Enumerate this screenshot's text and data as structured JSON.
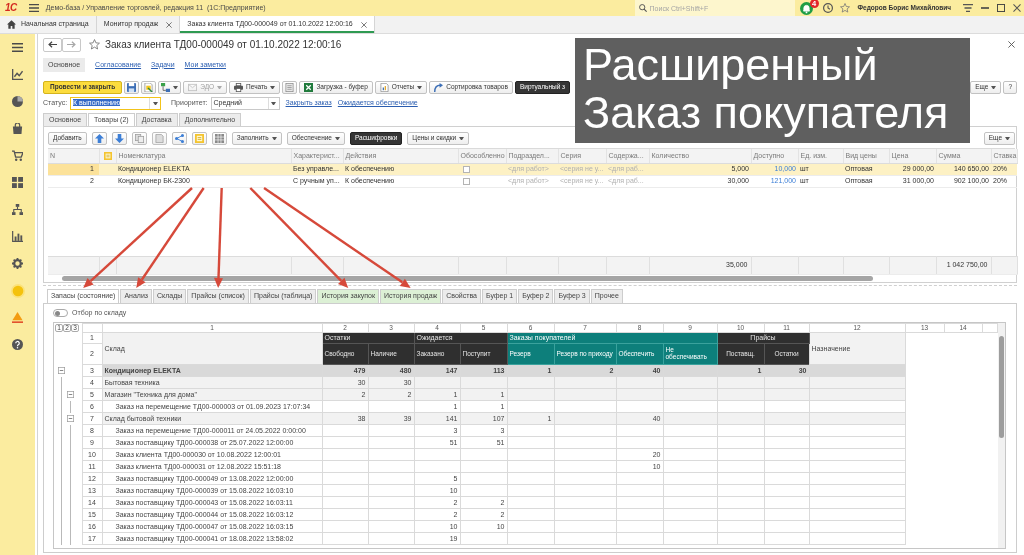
{
  "app_bar": {
    "logo": "1С",
    "title": "Демо-база / Управление торговлей, редакция 11  (1С:Предприятие)",
    "search": {
      "placeholder": "Поиск Ctrl+Shift+F"
    },
    "notification_count": "4",
    "user": "Федоров Борис Михайлович"
  },
  "open_tabs": [
    {
      "kind": "home",
      "label": "Начальная страница",
      "selected": false
    },
    {
      "kind": "document",
      "label": "Монитор продаж",
      "selected": false
    },
    {
      "kind": "document",
      "label": "Заказ клиента ТД00-000049 от 01.10.2022 12:00:16",
      "selected": true
    }
  ],
  "form": {
    "title": "Заказ клиента ТД00-000049 от 01.10.2022 12:00:16",
    "sections": [
      {
        "label": "Основное",
        "selected": true
      },
      {
        "label": "Согласование",
        "selected": false
      },
      {
        "label": "Задачи",
        "selected": false
      },
      {
        "label": "Мои заметки",
        "selected": false
      }
    ],
    "commands": [
      {
        "kind": "primary",
        "label": "Провести и закрыть",
        "dropdown": false,
        "disabled": false
      },
      {
        "kind": "icon",
        "dropdown": false,
        "disabled": false
      },
      {
        "kind": "icon",
        "dropdown": false,
        "disabled": false
      },
      {
        "kind": "icon",
        "dropdown": true,
        "disabled": false
      },
      {
        "kind": "icon-text",
        "label": "ЭДО",
        "dropdown": true,
        "disabled": true
      },
      {
        "kind": "icon-text",
        "label": "Печать",
        "dropdown": true,
        "disabled": false
      },
      {
        "kind": "icon",
        "dropdown": false,
        "disabled": false
      },
      {
        "kind": "icon-text",
        "label": "Загрузка - буфер",
        "dropdown": false,
        "disabled": false
      },
      {
        "kind": "icon-text",
        "label": "Отчеты",
        "dropdown": true,
        "disabled": false
      },
      {
        "kind": "icon-text",
        "label": "Сортировка товаров",
        "dropdown": false,
        "disabled": false
      },
      {
        "kind": "toggle",
        "label": "Виртуальный з",
        "dropdown": false,
        "disabled": false
      }
    ],
    "commands_right": [
      {
        "kind": "text",
        "label": "Еще",
        "dropdown": true,
        "disabled": false
      },
      {
        "kind": "text",
        "label": "?",
        "dropdown": false,
        "disabled": false
      }
    ],
    "fields": [
      {
        "label": "Статус:",
        "value": "К выполнению",
        "focused": true
      },
      {
        "label": "Приоритет:",
        "value": "Средний",
        "focused": false
      }
    ],
    "links": [
      "Закрыть заказ",
      "Ожидается обеспечение"
    ],
    "tabs": [
      {
        "label": "Основное",
        "selected": false
      },
      {
        "label": "Товары (2)",
        "selected": true
      },
      {
        "label": "Доставка",
        "selected": false
      },
      {
        "label": "Дополнительно",
        "selected": false
      }
    ],
    "goods": {
      "toolbar": [
        {
          "kind": "text",
          "label": "Добавить",
          "dropdown": false,
          "disabled": false
        },
        {
          "kind": "icon",
          "dropdown": false,
          "disabled": false
        },
        {
          "kind": "icon",
          "dropdown": false,
          "disabled": false
        },
        {
          "kind": "icon",
          "dropdown": false,
          "disabled": false
        },
        {
          "kind": "icon",
          "dropdown": false,
          "disabled": false
        },
        {
          "kind": "icon",
          "dropdown": false,
          "disabled": false
        },
        {
          "kind": "icon",
          "dropdown": false,
          "disabled": false
        },
        {
          "kind": "icon",
          "dropdown": false,
          "disabled": false
        },
        {
          "kind": "text",
          "label": "Заполнить",
          "dropdown": true,
          "disabled": false
        },
        {
          "kind": "text",
          "label": "Обеспечение",
          "dropdown": true,
          "disabled": false
        },
        {
          "kind": "toggle",
          "label": "Расшифровки",
          "dropdown": false,
          "disabled": false
        },
        {
          "kind": "text",
          "label": "Цены и скидки",
          "dropdown": true,
          "disabled": false
        }
      ],
      "toolbar_right": [
        {
          "kind": "text",
          "label": "Еще",
          "dropdown": true,
          "disabled": false
        }
      ],
      "columns": [
        {
          "kind": "text",
          "label": "N"
        },
        {
          "kind": "icon"
        },
        {
          "kind": "text",
          "label": "Номенклатура"
        },
        {
          "kind": "text",
          "label": "Характерист..."
        },
        {
          "kind": "text",
          "label": "Действия"
        },
        {
          "kind": "text",
          "label": "Обособленно"
        },
        {
          "kind": "text",
          "label": "Подраздел..."
        },
        {
          "kind": "text",
          "label": "Серия"
        },
        {
          "kind": "text",
          "label": "Содержа..."
        },
        {
          "kind": "text",
          "label": "Количество"
        },
        {
          "kind": "text",
          "label": "Доступно"
        },
        {
          "kind": "text",
          "label": "Ед. изм."
        },
        {
          "kind": "text",
          "label": "Вид цены"
        },
        {
          "kind": "text",
          "label": "Цена"
        },
        {
          "kind": "text",
          "label": "Сумма"
        },
        {
          "kind": "text",
          "label": "Ставка"
        }
      ],
      "rows": [
        {
          "selected": true,
          "n": "1",
          "name": "Кондиционер ELEKTA",
          "characteristic": "Без управле...",
          "action": "К обеспечению",
          "separate": false,
          "division": "<для работ>",
          "series": "<серия не у...",
          "content": "<для раб...",
          "quantity": "5,000",
          "available": "10,000",
          "unit": "шт",
          "price_type": "Оптовая",
          "price": "29 000,00",
          "sum": "140 650,00",
          "vat": "20%"
        },
        {
          "selected": false,
          "n": "2",
          "name": "Кондиционер БК-2300",
          "characteristic": "С ручным уп...",
          "action": "К обеспечению",
          "separate": false,
          "division": "<для работ>",
          "series": "<серия не у...",
          "content": "<для раб...",
          "quantity": "30,000",
          "available": "121,000",
          "unit": "шт",
          "price_type": "Оптовая",
          "price": "31 000,00",
          "sum": "902 100,00",
          "vat": "20%"
        }
      ],
      "totals": {
        "quantity": "35,000",
        "sum": "1 042 750,00"
      }
    },
    "bottom_tabs": [
      {
        "label": "Запасы (состояние)",
        "selected": true,
        "highlighted": false,
        "arrow": true
      },
      {
        "label": "Анализ",
        "selected": false,
        "highlighted": false,
        "arrow": true
      },
      {
        "label": "Склады",
        "selected": false,
        "highlighted": false,
        "arrow": false
      },
      {
        "label": "Прайсы (список)",
        "selected": false,
        "highlighted": false,
        "arrow": true
      },
      {
        "label": "Прайсы (таблица)",
        "selected": false,
        "highlighted": false,
        "arrow": false
      },
      {
        "label": "История закупок",
        "selected": false,
        "highlighted": true,
        "arrow": true
      },
      {
        "label": "История продаж",
        "selected": false,
        "highlighted": true,
        "arrow": true
      },
      {
        "label": "Свойства",
        "selected": false,
        "highlighted": false,
        "arrow": false
      },
      {
        "label": "Буфер 1",
        "selected": false,
        "highlighted": false,
        "arrow": false
      },
      {
        "label": "Буфер 2",
        "selected": false,
        "highlighted": false,
        "arrow": false
      },
      {
        "label": "Буфер 3",
        "selected": false,
        "highlighted": false,
        "arrow": false
      },
      {
        "label": "Прочее",
        "selected": false,
        "highlighted": false,
        "arrow": false
      }
    ],
    "filter_toggle": {
      "label": "Отбор по складу",
      "on": false
    },
    "report": {
      "levels": [
        "1",
        "2",
        "3"
      ],
      "column_numbers": [
        "1",
        "2",
        "3",
        "4",
        "5",
        "6",
        "7",
        "8",
        "9",
        "10",
        "11",
        "12",
        "13",
        "14"
      ],
      "header_row_numbers": [
        "1",
        "2"
      ],
      "first_column": "Склад",
      "groups": [
        {
          "label": "Остатки",
          "kind": "dark",
          "columns": [
            "Свободно",
            "Наличие"
          ]
        },
        {
          "label": "Ожидается",
          "kind": "dark",
          "columns": [
            "Заказано",
            "Поступит"
          ]
        },
        {
          "label": "Заказы покупателей",
          "kind": "teal",
          "columns": [
            "Резерв",
            "Резерв по приходу",
            "Обеспечить",
            "Не обеспечивать"
          ]
        },
        {
          "label": "Прайсы",
          "kind": "centered",
          "columns": [
            "Поставщ.",
            "Остатки"
          ]
        }
      ],
      "last_column": "Назначение",
      "rows": [
        {
          "number": "3",
          "name": "Кондиционер ELEKTA",
          "expanded": true,
          "values": {
            "free": "479",
            "on_hand": "480",
            "ordered": "147",
            "incoming": "113",
            "reserve": "1",
            "reserve_by_receipt": "2",
            "to_provide": "40",
            "supplier_prices": "1",
            "stock_prices": "30"
          },
          "children": [
            {
              "number": "4",
              "name": "Бытовая техника",
              "values": {
                "free": "30",
                "on_hand": "30"
              }
            },
            {
              "number": "5",
              "name": "Магазин \"Техника для дома\"",
              "expanded": true,
              "values": {
                "free": "2",
                "on_hand": "2",
                "ordered": "1",
                "incoming": "1"
              },
              "children": [
                {
                  "number": "6",
                  "name": "Заказ на перемещение ТД00-000003 от 01.09.2023 17:07:34",
                  "values": {
                    "ordered": "1",
                    "incoming": "1"
                  }
                }
              ]
            },
            {
              "number": "7",
              "name": "Склад бытовой техники",
              "expanded": true,
              "values": {
                "free": "38",
                "on_hand": "39",
                "ordered": "141",
                "incoming": "107",
                "reserve": "1",
                "to_provide": "40"
              },
              "children": [
                {
                  "number": "8",
                  "name": "Заказ на перемещение ТД00-000011 от 24.05.2022 0:00:00",
                  "values": {
                    "ordered": "3",
                    "incoming": "3"
                  }
                },
                {
                  "number": "9",
                  "name": "Заказ поставщику ТД00-000038 от 25.07.2022 12:00:00",
                  "values": {
                    "ordered": "51",
                    "incoming": "51"
                  }
                },
                {
                  "number": "10",
                  "name": "Заказ клиента ТД00-000030 от 10.08.2022 12:00:01",
                  "values": {
                    "to_provide": "20"
                  }
                },
                {
                  "number": "11",
                  "name": "Заказ клиента ТД00-000031 от 12.08.2022 15:51:18",
                  "values": {
                    "to_provide": "10"
                  }
                },
                {
                  "number": "12",
                  "name": "Заказ поставщику ТД00-000049 от 13.08.2022 12:00:00",
                  "values": {
                    "ordered": "5"
                  }
                },
                {
                  "number": "13",
                  "name": "Заказ поставщику ТД00-000039 от 15.08.2022 16:03:10",
                  "values": {
                    "ordered": "10"
                  }
                },
                {
                  "number": "14",
                  "name": "Заказ поставщику ТД00-000043 от 15.08.2022 16:03:11",
                  "values": {
                    "ordered": "2",
                    "incoming": "2"
                  }
                },
                {
                  "number": "15",
                  "name": "Заказ поставщику ТД00-000044 от 15.08.2022 16:03:12",
                  "values": {
                    "ordered": "2",
                    "incoming": "2"
                  }
                },
                {
                  "number": "16",
                  "name": "Заказ поставщику ТД00-000047 от 15.08.2022 16:03:15",
                  "values": {
                    "ordered": "10",
                    "incoming": "10"
                  }
                },
                {
                  "number": "17",
                  "name": "Заказ поставщику ТД00-000041 от 18.08.2022 13:58:02",
                  "values": {
                    "ordered": "19"
                  }
                }
              ]
            }
          ]
        }
      ]
    }
  },
  "caption": "Расширенный Заказ покупателя"
}
